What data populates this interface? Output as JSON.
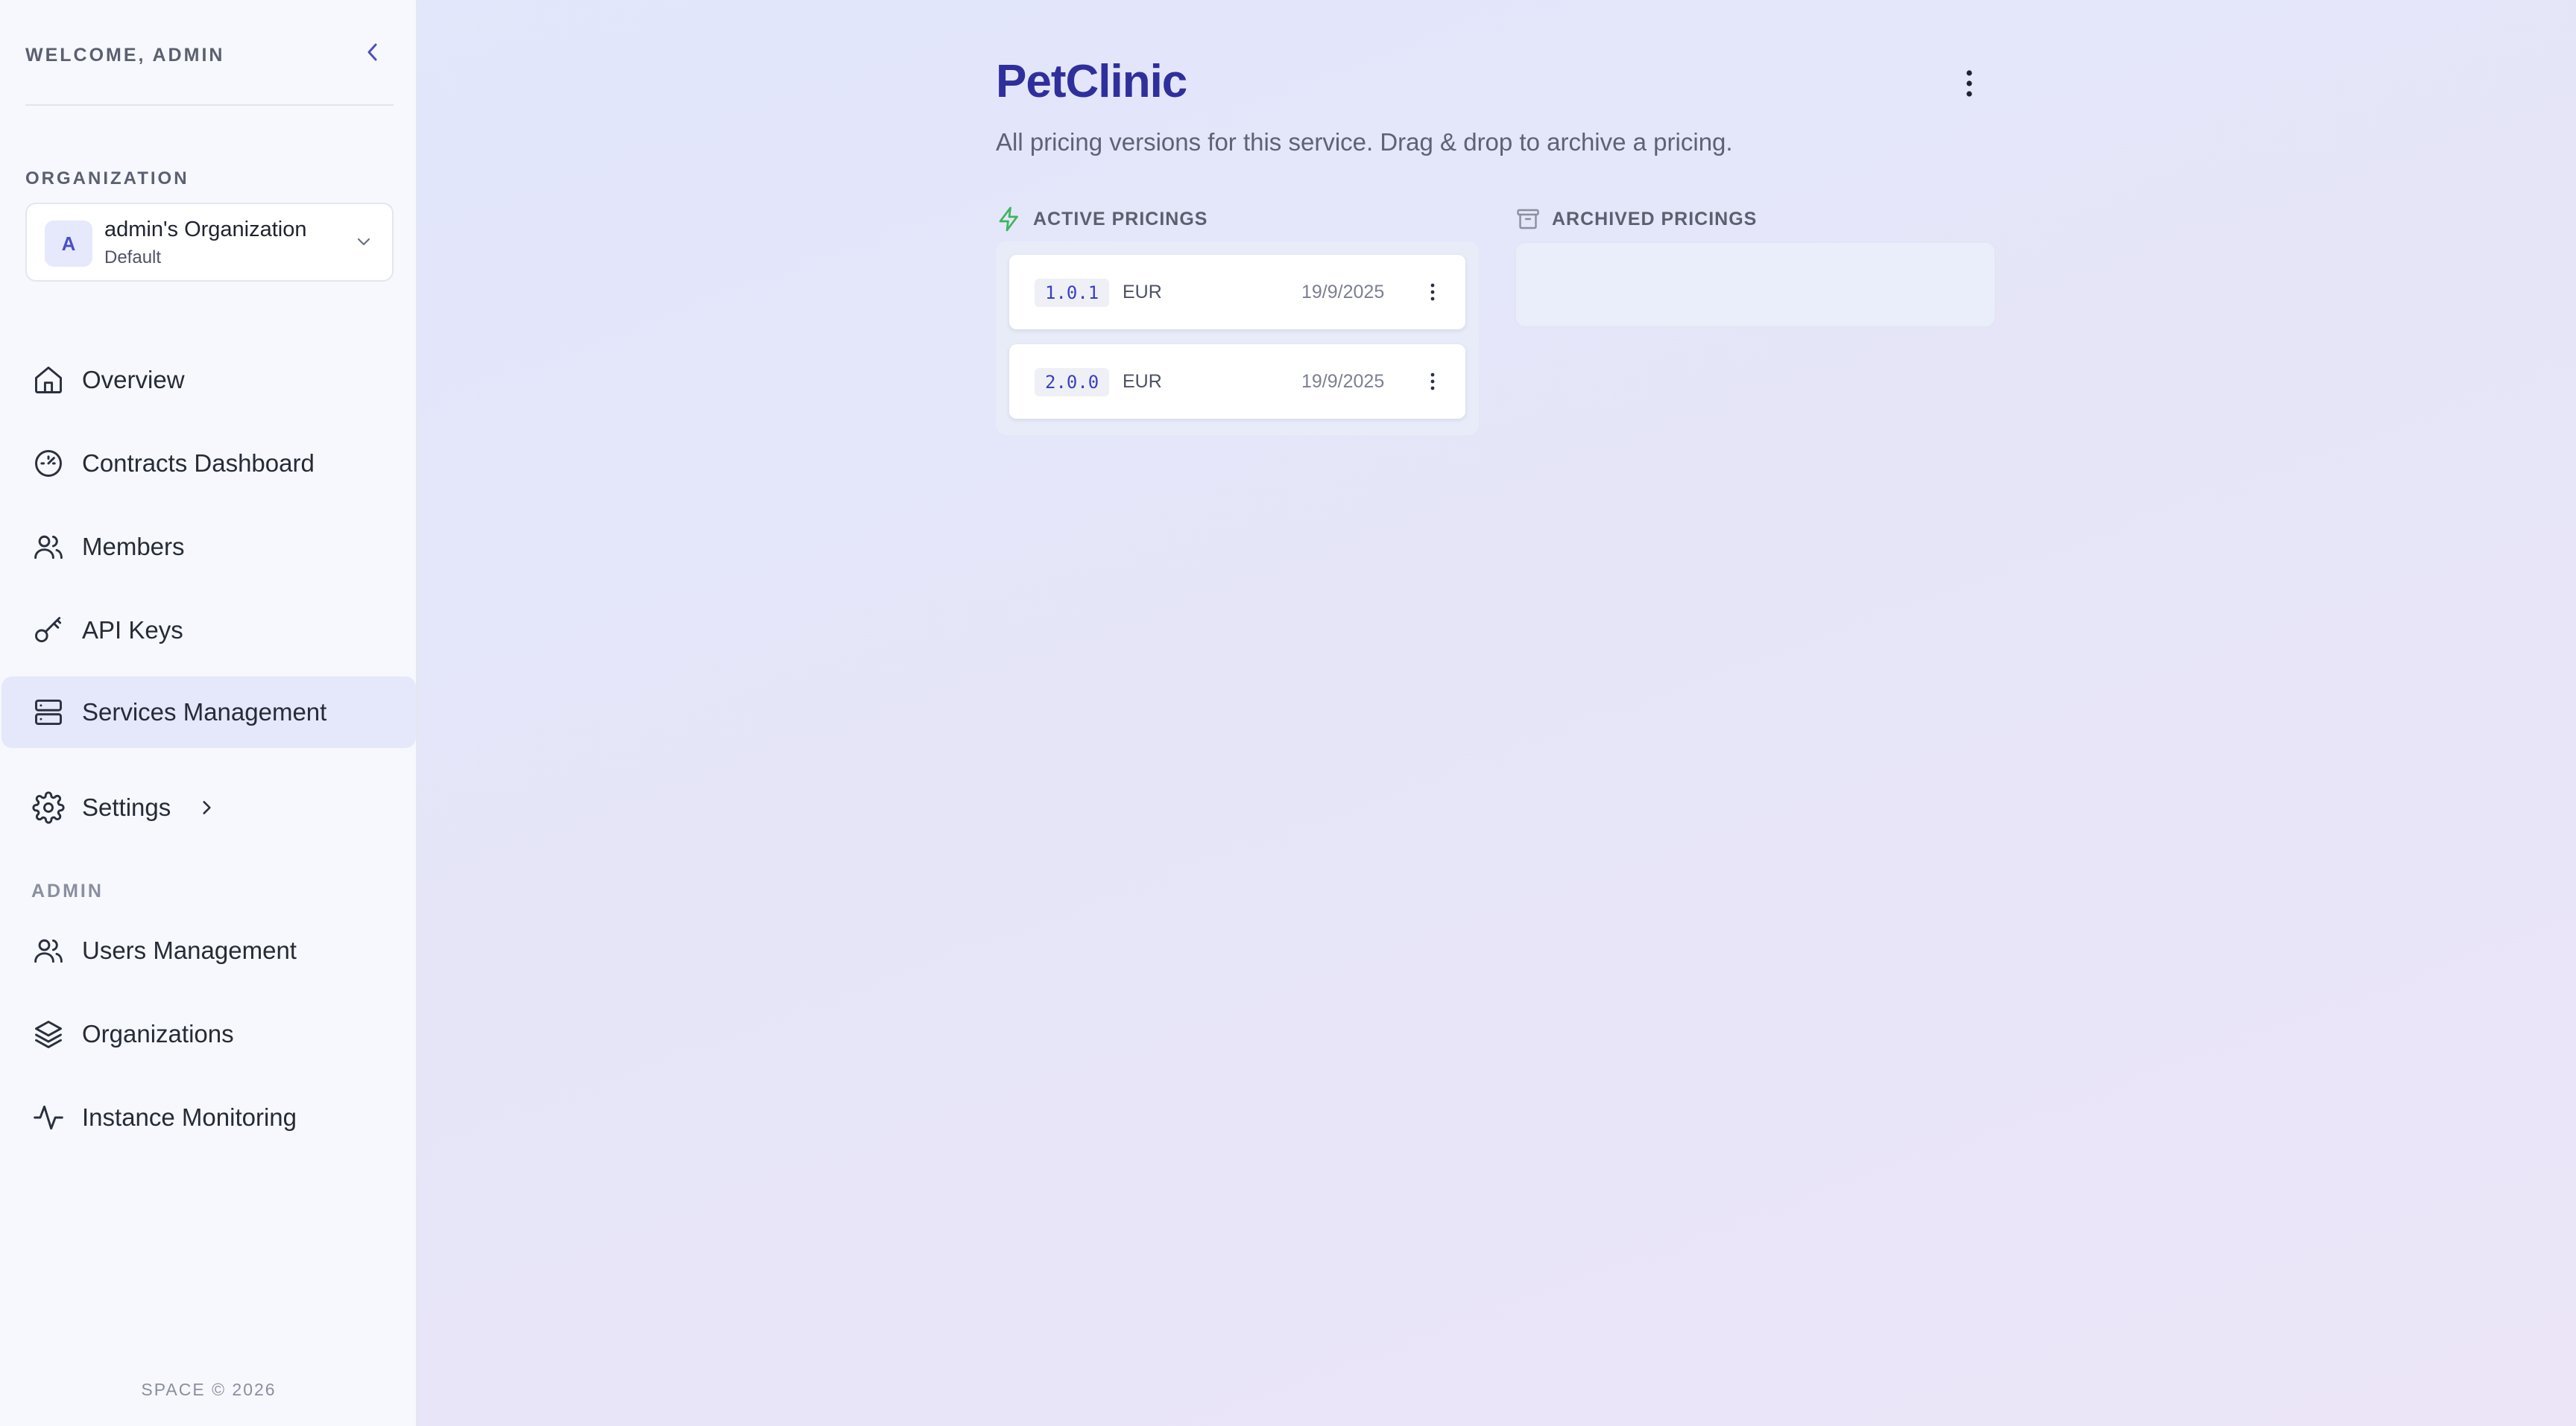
{
  "sidebar": {
    "welcome": "WELCOME, ADMIN",
    "organization_label": "ORGANIZATION",
    "organization": {
      "avatar_letter": "A",
      "name": "admin's Organization",
      "role": "Default"
    },
    "nav": [
      {
        "label": "Overview",
        "icon": "home-icon"
      },
      {
        "label": "Contracts Dashboard",
        "icon": "gauge-icon"
      },
      {
        "label": "Members",
        "icon": "users-icon"
      },
      {
        "label": "API Keys",
        "icon": "key-icon"
      },
      {
        "label": "Services Management",
        "icon": "server-icon",
        "active": true
      },
      {
        "label": "Settings",
        "icon": "gear-icon",
        "has_submenu": true
      }
    ],
    "admin_label": "ADMIN",
    "admin_nav": [
      {
        "label": "Users Management",
        "icon": "users-icon"
      },
      {
        "label": "Organizations",
        "icon": "layers-icon"
      },
      {
        "label": "Instance Monitoring",
        "icon": "activity-icon"
      }
    ],
    "footer": "SPACE © 2026"
  },
  "main": {
    "title": "PetClinic",
    "subtitle": "All pricing versions for this service. Drag & drop to archive a pricing.",
    "active_section": {
      "label": "ACTIVE PRICINGS",
      "icon": "lightning-icon",
      "pricings": [
        {
          "version": "1.0.1",
          "currency": "EUR",
          "date": "19/9/2025"
        },
        {
          "version": "2.0.0",
          "currency": "EUR",
          "date": "19/9/2025"
        }
      ]
    },
    "archived_section": {
      "label": "ARCHIVED PRICINGS",
      "icon": "archive-icon",
      "pricings": []
    }
  },
  "colors": {
    "accent": "#2f2f9c",
    "active_nav_bg": "#e4e8fa",
    "active_icon": "#3cb55e"
  }
}
